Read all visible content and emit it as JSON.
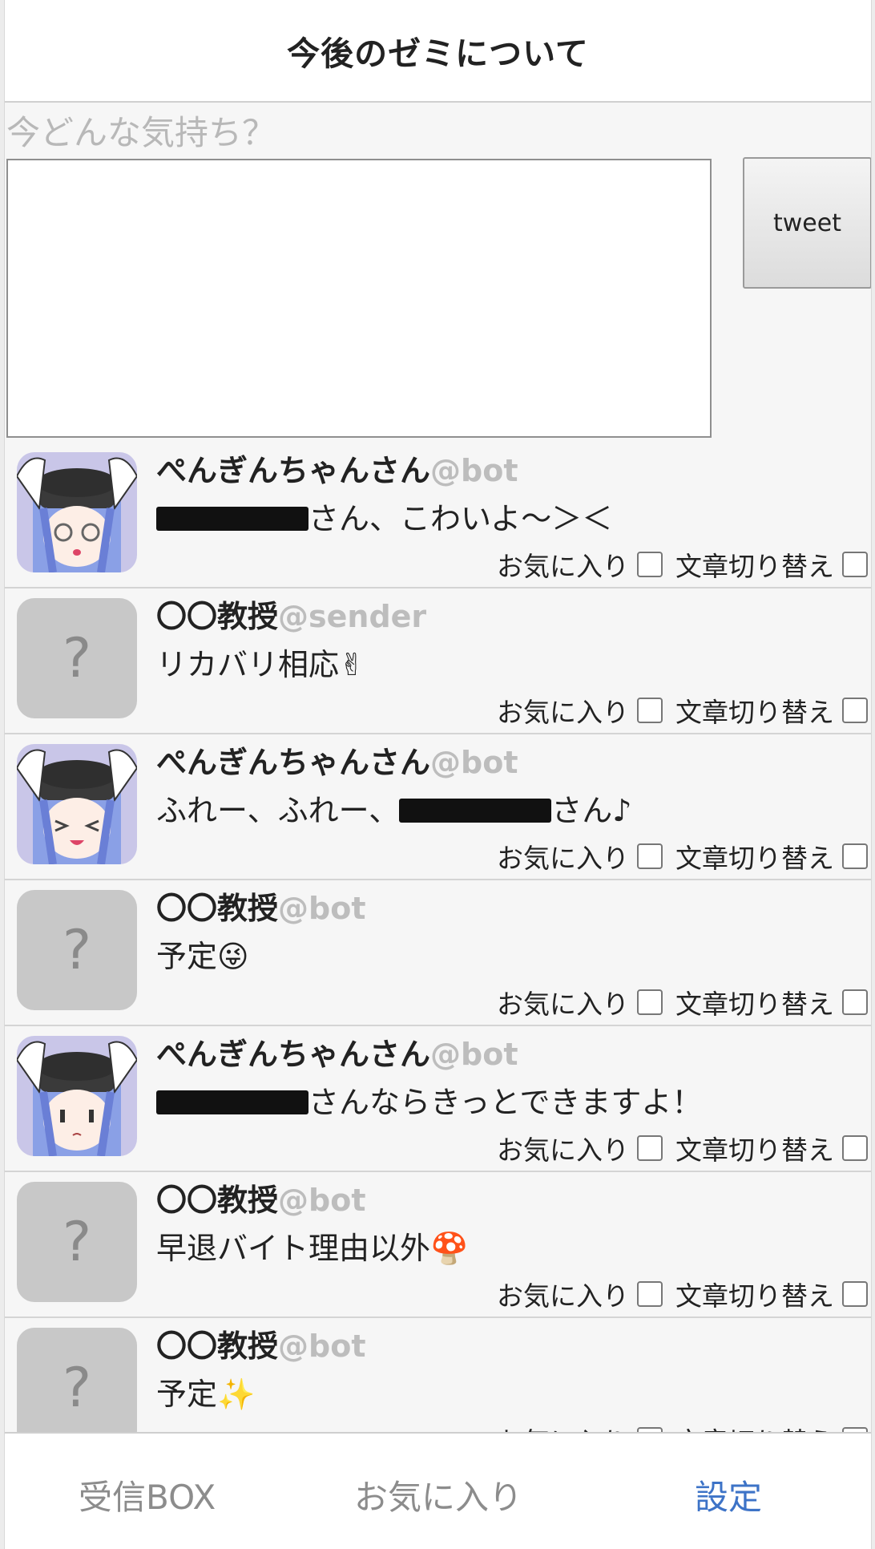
{
  "header": {
    "title": "今後のゼミについて"
  },
  "compose": {
    "prompt": "今どんな気持ち？",
    "value": "",
    "tweet_label": "tweet"
  },
  "item_options": {
    "favorite_label": "お気に入り",
    "toggle_text_label": "文章切り替え"
  },
  "timeline": [
    {
      "name": "ぺんぎんちゃんさん",
      "handle": "@bot",
      "avatar": "penguin-girl",
      "text_before": "",
      "text_after": "さん、こわいよ〜＞＜",
      "emoji": ""
    },
    {
      "name": "〇〇教授",
      "handle": "@sender",
      "avatar": "placeholder",
      "text_before": "リカバリ相応",
      "text_after": "",
      "emoji": "✌"
    },
    {
      "name": "ぺんぎんちゃんさん",
      "handle": "@bot",
      "avatar": "penguin-girl-laugh",
      "text_before": "ふれー、ふれー、",
      "text_after": "さん♪",
      "emoji": ""
    },
    {
      "name": "〇〇教授",
      "handle": "@bot",
      "avatar": "placeholder",
      "text_before": "予定",
      "text_after": "",
      "emoji": "😜"
    },
    {
      "name": "ぺんぎんちゃんさん",
      "handle": "@bot",
      "avatar": "penguin-girl",
      "text_before": "",
      "text_after": "さんならきっとできますよ！",
      "emoji": ""
    },
    {
      "name": "〇〇教授",
      "handle": "@bot",
      "avatar": "placeholder",
      "text_before": "早退バイト理由以外",
      "text_after": "",
      "emoji": "🍄"
    },
    {
      "name": "〇〇教授",
      "handle": "@bot",
      "avatar": "placeholder",
      "text_before": "予定",
      "text_after": "",
      "emoji": "✨"
    }
  ],
  "placeholder_avatar_glyph": "?",
  "tabbar": {
    "tabs": [
      {
        "label": "受信BOX",
        "active": false
      },
      {
        "label": "お気に入り",
        "active": false
      },
      {
        "label": "設定",
        "active": true
      }
    ],
    "active_color": "#3d73c7"
  }
}
